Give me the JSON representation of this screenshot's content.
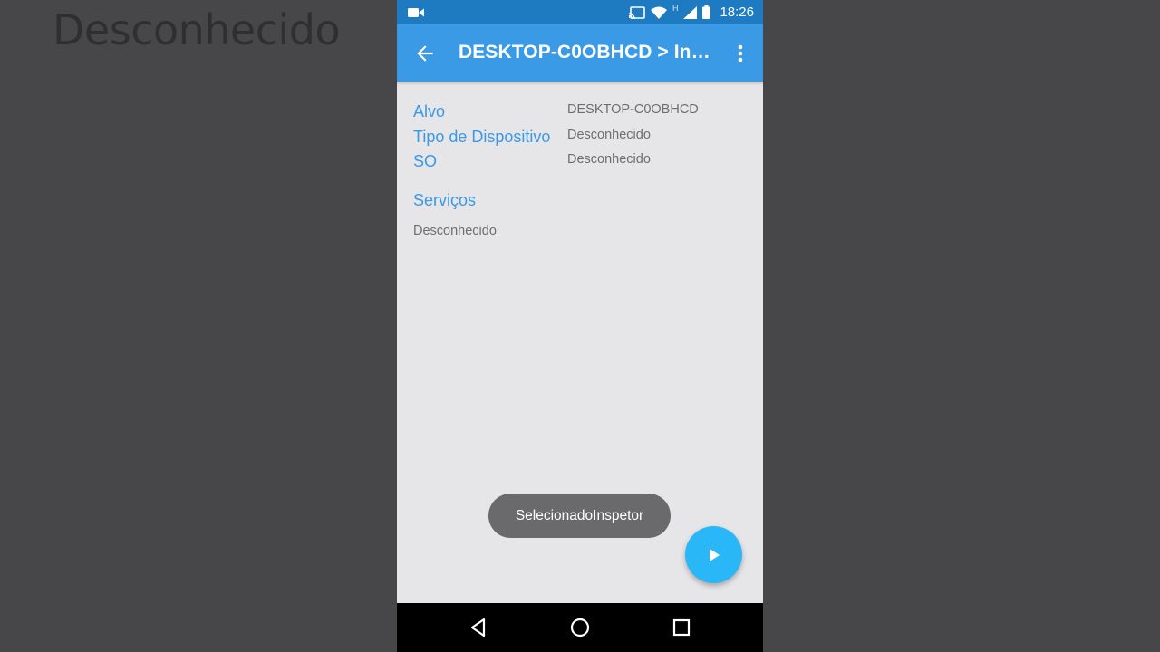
{
  "background": {
    "text": "Desconhecido"
  },
  "status_bar": {
    "time": "18:26",
    "network": "H",
    "icons": [
      "video-camera-icon",
      "cast-icon",
      "wifi-icon",
      "signal-icon",
      "battery-icon"
    ]
  },
  "app_bar": {
    "title": "DESKTOP-C0OBHCD > Ins...",
    "back_icon": "arrow-back-icon",
    "menu_icon": "more-vert-icon"
  },
  "info": {
    "rows": [
      {
        "label": "Alvo",
        "value": "DESKTOP-C0OBHCD"
      },
      {
        "label": "Tipo de Dispositivo",
        "value": "Desconhecido"
      },
      {
        "label": "SO",
        "value": "Desconhecido"
      }
    ]
  },
  "services": {
    "title": "Serviços",
    "value": "Desconhecido"
  },
  "toast": {
    "text": "SelecionadoInspetor"
  },
  "fab": {
    "icon": "play-icon"
  },
  "nav_bar": {
    "icons": [
      "back-triangle-icon",
      "home-circle-icon",
      "recents-square-icon"
    ]
  },
  "colors": {
    "status_bar": "#1e7bc2",
    "app_bar": "#3a9ae6",
    "accent": "#2ab7f8",
    "label": "#3a9ae6",
    "value": "#6e6e72",
    "screen_bg": "#e6e5e8"
  }
}
